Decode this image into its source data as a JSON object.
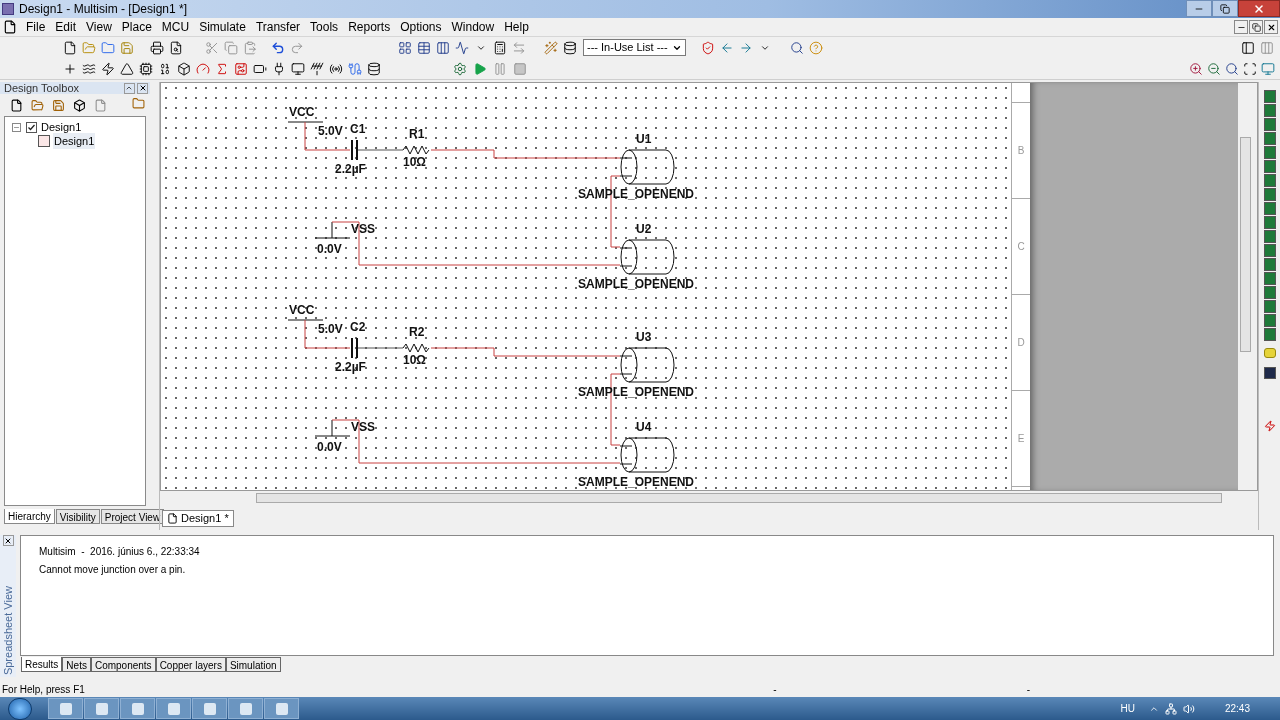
{
  "window": {
    "title": "Design1 - Multisim - [Design1 *]"
  },
  "menu": [
    "File",
    "Edit",
    "View",
    "Place",
    "MCU",
    "Simulate",
    "Transfer",
    "Tools",
    "Reports",
    "Options",
    "Window",
    "Help"
  ],
  "toolbar": {
    "component_list": "--- In-Use List ---"
  },
  "design_toolbox": {
    "title": "Design Toolbox",
    "tree": [
      {
        "label": "Design1",
        "expanded": true,
        "selected": false,
        "children": [
          {
            "label": "Design1",
            "selected": true
          }
        ]
      }
    ],
    "tabs": [
      {
        "label": "Hierarchy",
        "selected": true
      },
      {
        "label": "Visibility",
        "selected": false
      },
      {
        "label": "Project View",
        "selected": false
      }
    ]
  },
  "schematic": {
    "border_labels": [
      "B",
      "C",
      "D",
      "E"
    ],
    "circuits": [
      {
        "source": "VCC",
        "source_voltage": "5.0V",
        "capacitor": "C1",
        "capacitance": "2.2µF",
        "resistor": "R1",
        "resistance": "10Ω",
        "ground": "VSS",
        "ground_voltage": "0.0V",
        "connectors": [
          {
            "ref": "U1",
            "part": "SAMPLE_OPENEND"
          },
          {
            "ref": "U2",
            "part": "SAMPLE_OPENEND"
          }
        ]
      },
      {
        "source": "VCC",
        "source_voltage": "5.0V",
        "capacitor": "C2",
        "capacitance": "2.2µF",
        "resistor": "R2",
        "resistance": "10Ω",
        "ground": "VSS",
        "ground_voltage": "0.0V",
        "connectors": [
          {
            "ref": "U3",
            "part": "SAMPLE_OPENEND"
          },
          {
            "ref": "U4",
            "part": "SAMPLE_OPENEND"
          }
        ]
      }
    ]
  },
  "document_tabs": [
    {
      "label": "Design1 *",
      "selected": true
    }
  ],
  "spreadsheet": {
    "title": "Spreadsheet View",
    "messages": [
      "Multisim  -  2016. június 6., 22:33:34",
      "Cannot move junction over a pin."
    ],
    "tabs": [
      {
        "label": "Results",
        "selected": true
      },
      {
        "label": "Nets",
        "selected": false
      },
      {
        "label": "Components",
        "selected": false
      },
      {
        "label": "Copper layers",
        "selected": false
      },
      {
        "label": "Simulation",
        "selected": false
      }
    ]
  },
  "status_bar": {
    "help": "For Help, press F1",
    "fields": [
      "-",
      "-"
    ]
  },
  "taskbar": {
    "language": "HU",
    "clock": "22:43"
  }
}
